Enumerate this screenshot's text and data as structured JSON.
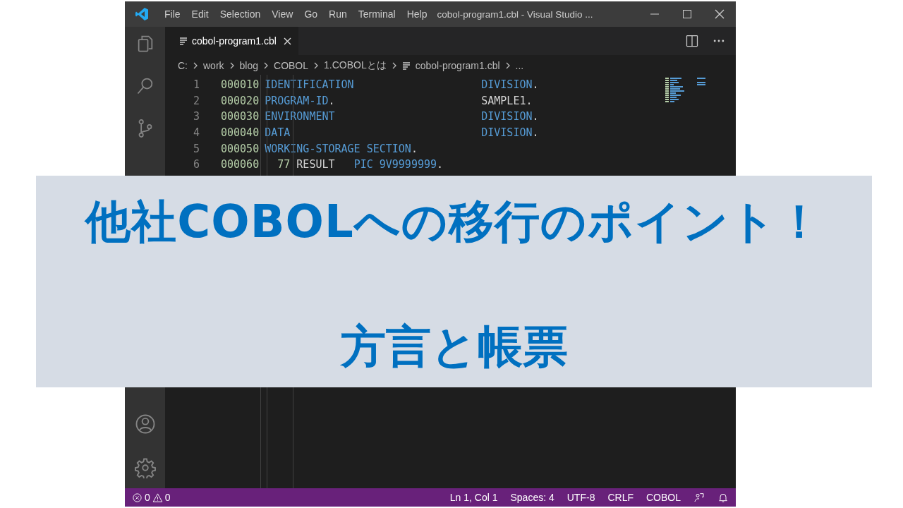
{
  "window": {
    "menu": [
      "File",
      "Edit",
      "Selection",
      "View",
      "Go",
      "Run",
      "Terminal",
      "Help"
    ],
    "title": "cobol-program1.cbl - Visual Studio ..."
  },
  "tabs": [
    {
      "label": "cobol-program1.cbl",
      "selected": true
    }
  ],
  "breadcrumb": {
    "parts": [
      "C:",
      "work",
      "blog",
      "COBOL",
      "1.COBOLとは"
    ],
    "file": "cobol-program1.cbl",
    "more": "..."
  },
  "editor": {
    "lines": [
      {
        "number": "1",
        "seq": "000010",
        "tokens": [
          {
            "kind": "keyword",
            "text": "IDENTIFICATION                    DIVISION"
          },
          {
            "kind": "plain",
            "text": "."
          }
        ]
      },
      {
        "number": "2",
        "seq": "000020",
        "tokens": [
          {
            "kind": "keyword",
            "text": "PROGRAM-ID"
          },
          {
            "kind": "plain",
            "text": ".                       SAMPLE1."
          }
        ]
      },
      {
        "number": "3",
        "seq": "000030",
        "tokens": [
          {
            "kind": "keyword",
            "text": "ENVIRONMENT                       DIVISION"
          },
          {
            "kind": "plain",
            "text": "."
          }
        ]
      },
      {
        "number": "4",
        "seq": "000040",
        "tokens": [
          {
            "kind": "keyword",
            "text": "DATA                              DIVISION"
          },
          {
            "kind": "plain",
            "text": "."
          }
        ]
      },
      {
        "number": "5",
        "seq": "000050",
        "tokens": [
          {
            "kind": "keyword",
            "text": "WORKING-STORAGE SECTION"
          },
          {
            "kind": "plain",
            "text": "."
          }
        ]
      },
      {
        "number": "6",
        "seq": "000060",
        "tokens": [
          {
            "kind": "number",
            "text": "  77"
          },
          {
            "kind": "plain",
            "text": " RESULT   "
          },
          {
            "kind": "keyword",
            "text": "PIC 9V9999999"
          },
          {
            "kind": "plain",
            "text": "."
          }
        ]
      }
    ]
  },
  "status_bar": {
    "errors": "0",
    "warnings": "0",
    "items": [
      "Ln 1, Col 1",
      "Spaces: 4",
      "UTF-8",
      "CRLF",
      "COBOL"
    ]
  },
  "banner": {
    "lines": [
      "他社COBOLへの移行のポイント！",
      "方言と帳票"
    ]
  }
}
